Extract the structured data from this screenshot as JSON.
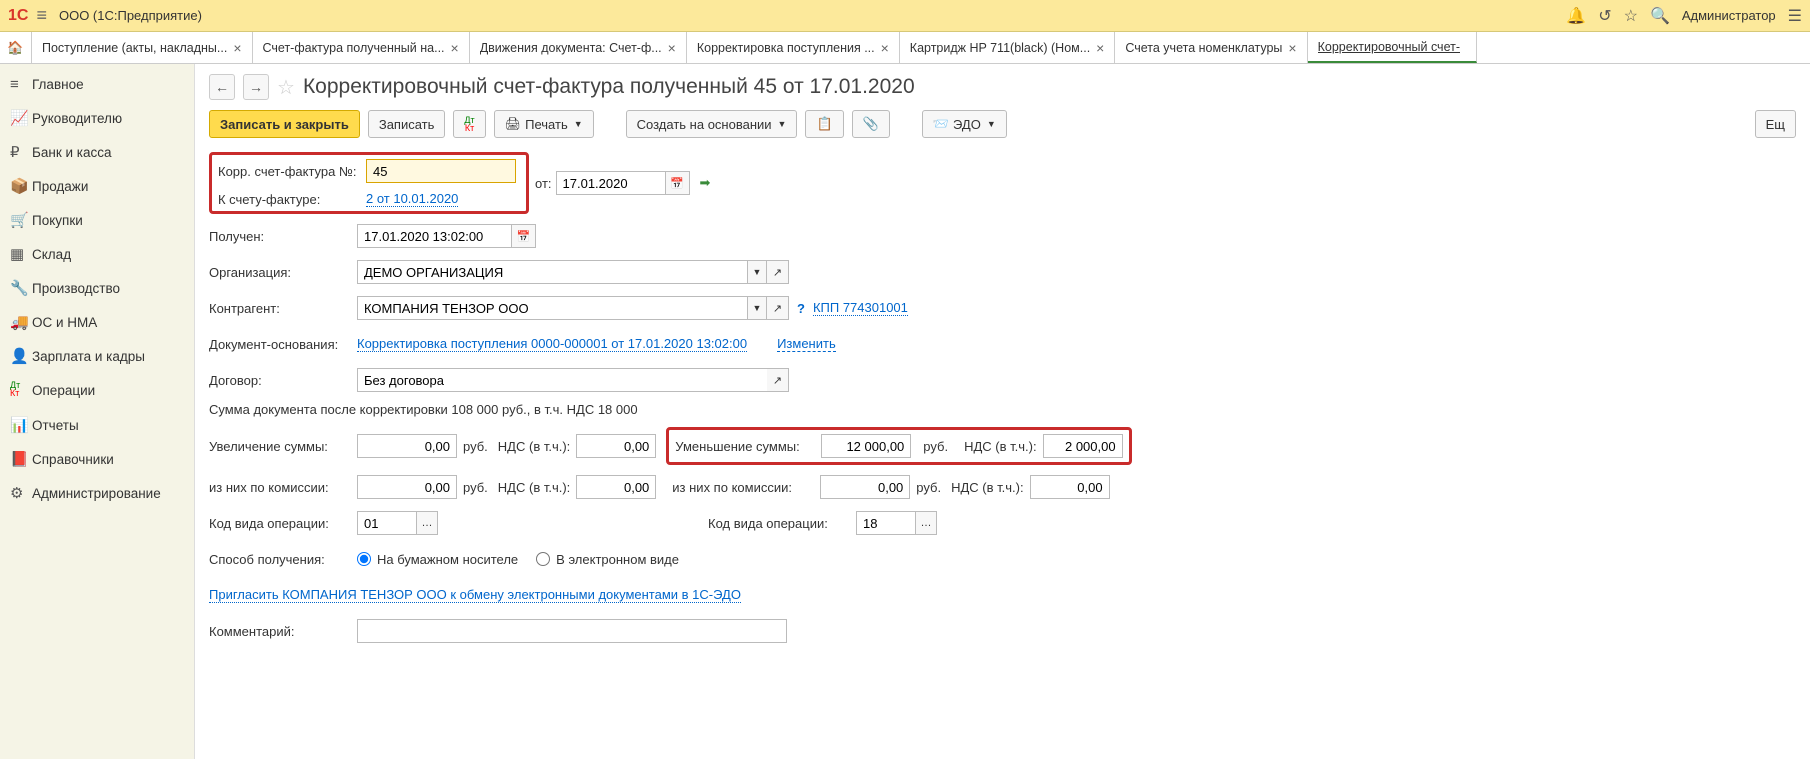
{
  "app": {
    "logo": "1C",
    "title": "ООО (1С:Предприятие)",
    "admin": "Администратор"
  },
  "tabs": [
    {
      "label": "Поступление (акты, накладны..."
    },
    {
      "label": "Счет-фактура полученный на..."
    },
    {
      "label": "Движения документа: Счет-ф..."
    },
    {
      "label": "Корректировка поступления ..."
    },
    {
      "label": "Картридж HP 711(black) (Ном..."
    },
    {
      "label": "Счета учета номенклатуры"
    },
    {
      "label": "Корректировочный счет-"
    }
  ],
  "sidebar": [
    {
      "icon": "≡",
      "label": "Главное"
    },
    {
      "icon": "📈",
      "label": "Руководителю"
    },
    {
      "icon": "₽",
      "label": "Банк и касса"
    },
    {
      "icon": "📦",
      "label": "Продажи"
    },
    {
      "icon": "🛒",
      "label": "Покупки"
    },
    {
      "icon": "▦",
      "label": "Склад"
    },
    {
      "icon": "🔧",
      "label": "Производство"
    },
    {
      "icon": "🚚",
      "label": "ОС и НМА"
    },
    {
      "icon": "👤",
      "label": "Зарплата и кадры"
    },
    {
      "icon": "Дт",
      "label": "Операции"
    },
    {
      "icon": "📊",
      "label": "Отчеты"
    },
    {
      "icon": "📕",
      "label": "Справочники"
    },
    {
      "icon": "⚙",
      "label": "Администрирование"
    }
  ],
  "doc": {
    "title": "Корректировочный счет-фактура полученный 45 от 17.01.2020",
    "toolbar": {
      "save_close": "Записать и закрыть",
      "save": "Записать",
      "print": "Печать",
      "create_based": "Создать на основании",
      "edo": "ЭДО",
      "more": "Ещ"
    },
    "fields": {
      "corr_num_label": "Корр. счет-фактура №:",
      "corr_num": "45",
      "from_label": "от:",
      "corr_date": "17.01.2020",
      "to_invoice_label": "К счету-фактуре:",
      "to_invoice": "2 от 10.01.2020",
      "received_label": "Получен:",
      "received": "17.01.2020 13:02:00",
      "org_label": "Организация:",
      "org": "ДЕМО ОРГАНИЗАЦИЯ",
      "cpty_label": "Контрагент:",
      "cpty": "КОМПАНИЯ ТЕНЗОР ООО",
      "kpp": "КПП 774301001",
      "basis_label": "Документ-основания:",
      "basis": "Корректировка поступления 0000-000001 от 17.01.2020 13:02:00",
      "basis_change": "Изменить",
      "contract_label": "Договор:",
      "contract": "Без договора",
      "sumtext": "Сумма документа после корректировки 108 000 руб., в т.ч. НДС 18 000",
      "inc_label": "Увеличение суммы:",
      "inc_amount": "0,00",
      "inc_vat": "0,00",
      "dec_label": "Уменьшение суммы:",
      "dec_amount": "12 000,00",
      "dec_vat": "2 000,00",
      "rub": "руб.",
      "vat_label": "НДС (в т.ч.):",
      "comm_label": "из них по комиссии:",
      "comm_inc_amount": "0,00",
      "comm_inc_vat": "0,00",
      "comm_dec_amount": "0,00",
      "comm_dec_vat": "0,00",
      "opcode_label": "Код вида операции:",
      "opcode1": "01",
      "opcode2": "18",
      "method_label": "Способ получения:",
      "method_paper": "На бумажном носителе",
      "method_electronic": "В электронном виде",
      "invite_link": "Пригласить КОМПАНИЯ ТЕНЗОР ООО к обмену электронными документами в 1С-ЭДО",
      "comment_label": "Комментарий:"
    }
  }
}
